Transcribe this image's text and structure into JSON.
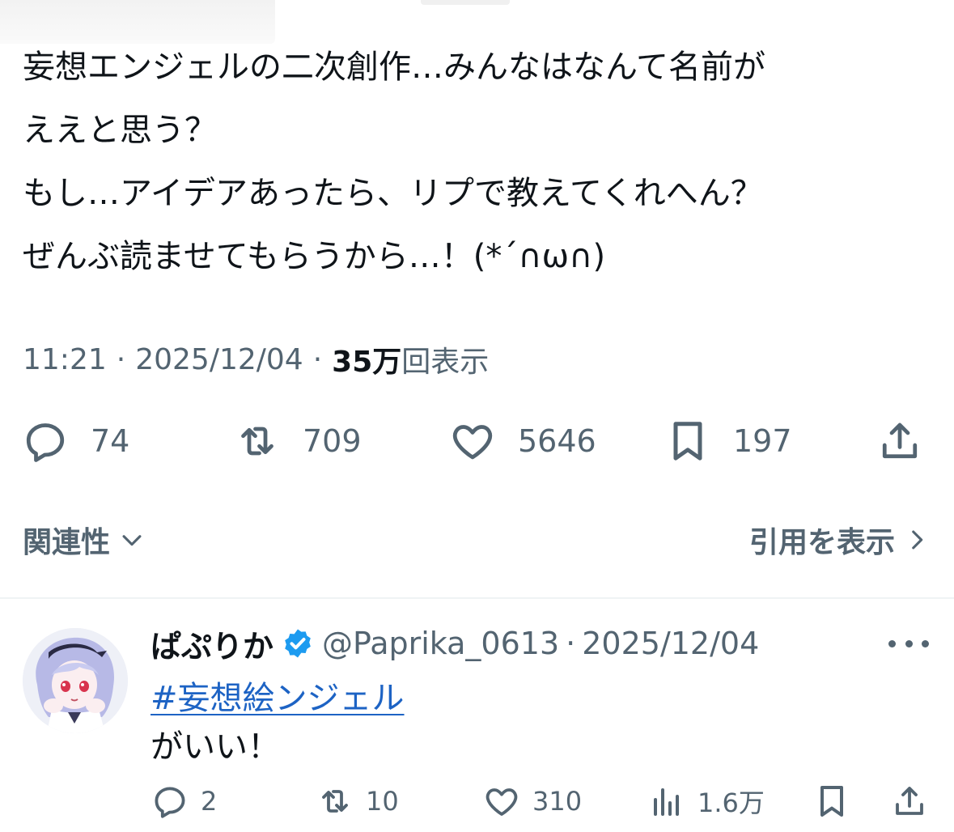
{
  "tweet": {
    "lines": [
      "妄想エンジェルの二次創作…みんなはなんて名前が",
      "ええと思う？",
      "もし…アイデアあったら、リプで教えてくれへん？",
      "ぜんぶ読ませてもらうから…！(*´∩ω∩)"
    ],
    "time": "11:21",
    "date": "2025/12/04",
    "views_count": "35万",
    "views_label": "回表示"
  },
  "actions": {
    "replies": "74",
    "retweets": "709",
    "likes": "5646",
    "bookmarks": "197"
  },
  "subbar": {
    "relevance_label": "関連性",
    "quotes_label": "引用を表示"
  },
  "reply": {
    "name": "ぱぷりか",
    "handle": "@Paprika_0613",
    "date": "2025/12/04",
    "hashtag": "#妄想絵ンジェル",
    "text": "がいい！",
    "actions": {
      "replies": "2",
      "retweets": "10",
      "likes": "310",
      "views": "1.6万"
    }
  },
  "colors": {
    "text": "#0f1419",
    "secondary": "#536471",
    "link": "#1d63c4",
    "verified": "#1d9bf0",
    "divider": "#eff3f4"
  }
}
